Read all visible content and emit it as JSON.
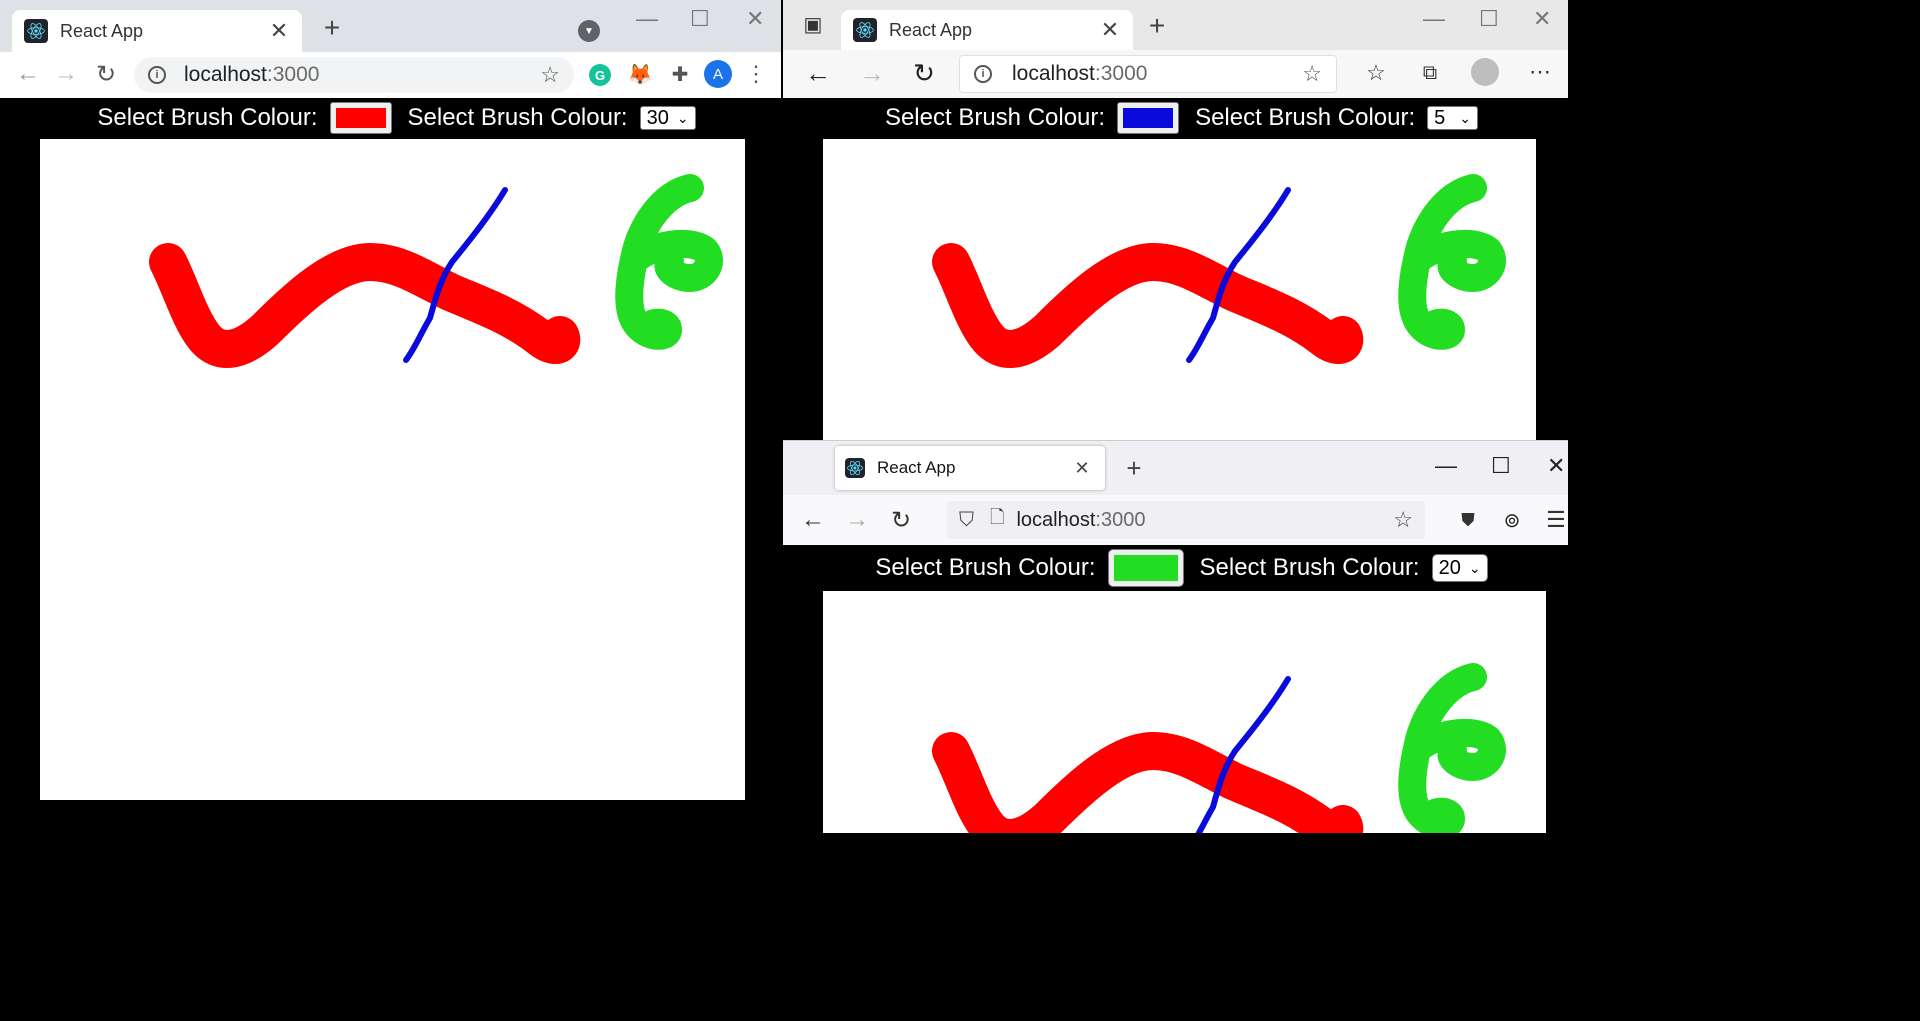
{
  "windows": [
    {
      "browser": "chrome",
      "tab_title": "React App",
      "url_host": "localhost",
      "url_port": ":3000",
      "extension_grammarly_letter": "G",
      "profile_letter": "A",
      "app": {
        "color_label": "Select Brush Colour:",
        "size_label": "Select Brush Colour:",
        "selected_color": "#ff0000",
        "selected_size": "30"
      }
    },
    {
      "browser": "edge",
      "tab_title": "React App",
      "url_host": "localhost",
      "url_port": ":3000",
      "app": {
        "color_label": "Select Brush Colour:",
        "size_label": "Select Brush Colour:",
        "selected_color": "#0a0adc",
        "selected_size": "5"
      }
    },
    {
      "browser": "firefox",
      "tab_title": "React App",
      "url_host": "localhost",
      "url_port": ":3000",
      "app": {
        "color_label": "Select Brush Colour:",
        "size_label": "Select Brush Colour:",
        "selected_color": "#22dd22",
        "selected_size": "20"
      }
    }
  ],
  "strokes": {
    "red": "#ff0000",
    "blue": "#0a0adc",
    "green": "#22dd22"
  }
}
